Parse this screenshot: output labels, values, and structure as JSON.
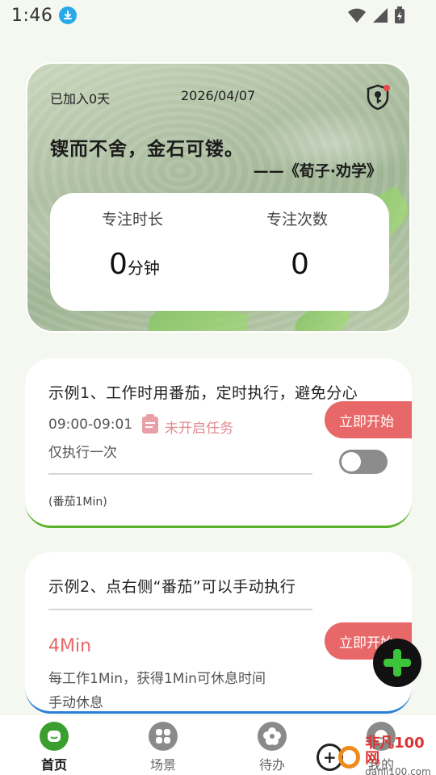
{
  "status_bar": {
    "time": "1:46"
  },
  "hero": {
    "joined_text": "已加入0天",
    "date": "2026/04/07",
    "quote": "锲而不舍，金石可镂。",
    "source": "——《荀子·劝学》",
    "stats": {
      "duration_label": "专注时长",
      "duration_value": "0",
      "duration_unit": "分钟",
      "count_label": "专注次数",
      "count_value": "0"
    }
  },
  "tasks": [
    {
      "title": "示例1、工作时用番茄，定时执行，避免分心",
      "time_range": "09:00-09:01",
      "status": "未开启任务",
      "repeat": "仅执行一次",
      "note": "(番茄1Min)",
      "start_label": "立即开始"
    },
    {
      "title": "示例2、点右侧“番茄”可以手动执行",
      "minutes": "4Min",
      "description": "每工作1Min，获得1Min可休息时间",
      "rest_mode": "手动休息",
      "start_label": "立即开始"
    }
  ],
  "bottom_nav": [
    {
      "label": "首页",
      "active": true
    },
    {
      "label": "场景",
      "active": false
    },
    {
      "label": "待办",
      "active": false
    },
    {
      "label": "我的",
      "active": false
    }
  ],
  "watermark": {
    "name": "非凡100网",
    "url": "danji100.com"
  },
  "colors": {
    "accent_green": "#3a9f2e",
    "start_button": "#e86768",
    "card1_border": "#58b32a",
    "card2_border": "#2a7fd6"
  }
}
